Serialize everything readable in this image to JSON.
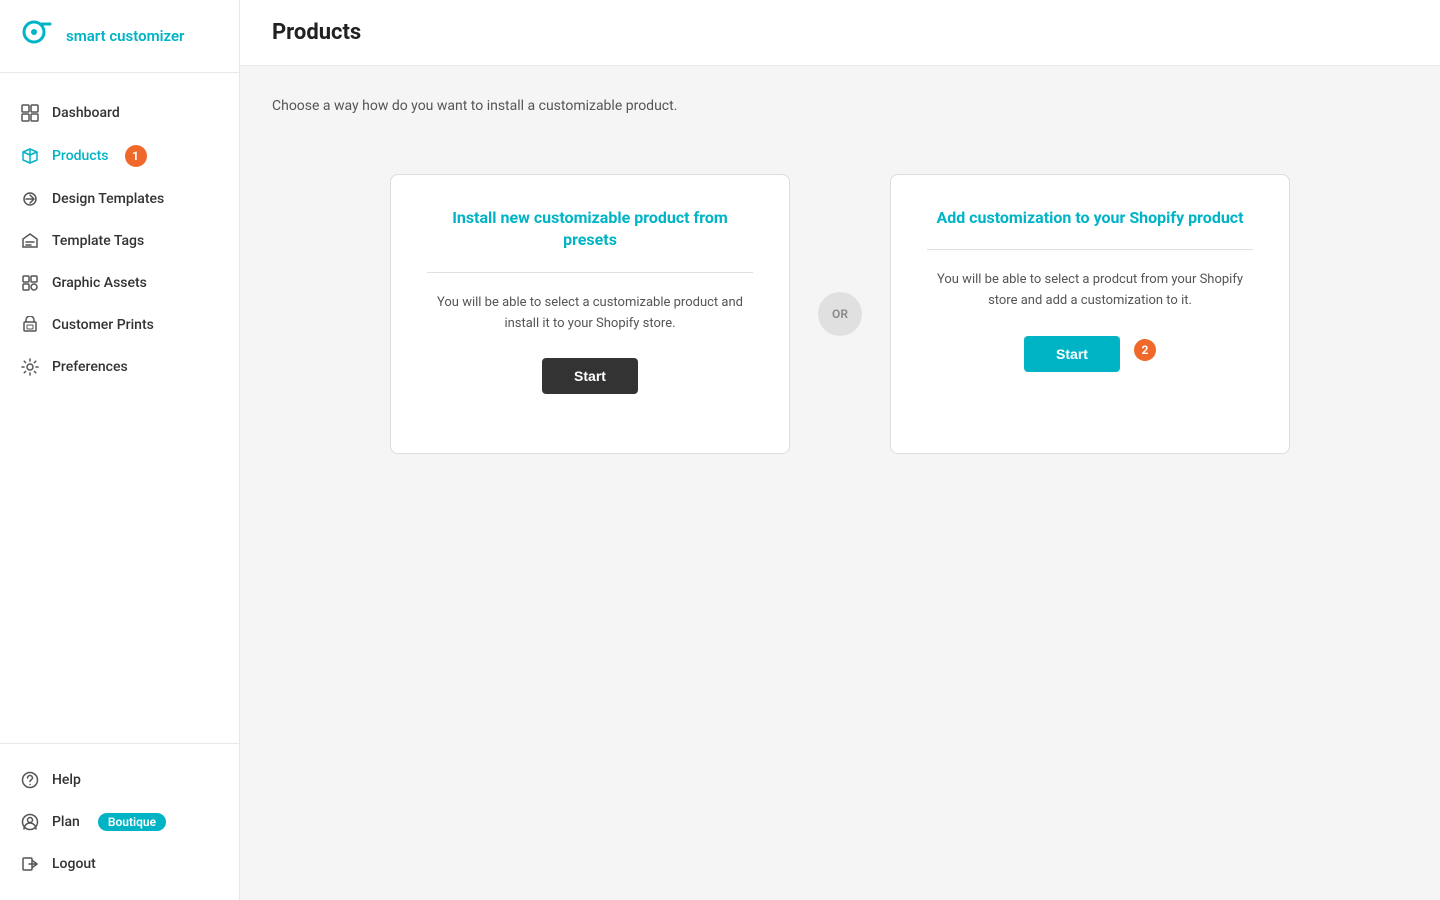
{
  "app": {
    "name": "smart customizer"
  },
  "sidebar": {
    "nav_items": [
      {
        "id": "dashboard",
        "label": "Dashboard",
        "icon": "dashboard-icon",
        "active": false,
        "badge": null
      },
      {
        "id": "products",
        "label": "Products",
        "icon": "products-icon",
        "active": true,
        "badge": "1"
      },
      {
        "id": "design-templates",
        "label": "Design Templates",
        "icon": "design-templates-icon",
        "active": false,
        "badge": null
      },
      {
        "id": "template-tags",
        "label": "Template Tags",
        "icon": "template-tags-icon",
        "active": false,
        "badge": null
      },
      {
        "id": "graphic-assets",
        "label": "Graphic Assets",
        "icon": "graphic-assets-icon",
        "active": false,
        "badge": null
      },
      {
        "id": "customer-prints",
        "label": "Customer Prints",
        "icon": "customer-prints-icon",
        "active": false,
        "badge": null
      },
      {
        "id": "preferences",
        "label": "Preferences",
        "icon": "preferences-icon",
        "active": false,
        "badge": null
      }
    ],
    "bottom_items": [
      {
        "id": "help",
        "label": "Help",
        "icon": "help-icon"
      },
      {
        "id": "plan",
        "label": "Plan",
        "icon": "plan-icon",
        "badge": "Boutique"
      },
      {
        "id": "logout",
        "label": "Logout",
        "icon": "logout-icon"
      }
    ]
  },
  "page": {
    "title": "Products",
    "subtitle": "Choose a way how do you want to install a customizable product."
  },
  "cards": {
    "or_label": "OR",
    "card1": {
      "title": "Install new customizable product from presets",
      "description": "You will be able to select a customizable product and install it to your Shopify store.",
      "button_label": "Start"
    },
    "card2": {
      "title": "Add customization to your Shopify product",
      "description": "You will be able to select a prodcut from your Shopify store and add a customization to it.",
      "button_label": "Start",
      "badge": "2"
    }
  }
}
